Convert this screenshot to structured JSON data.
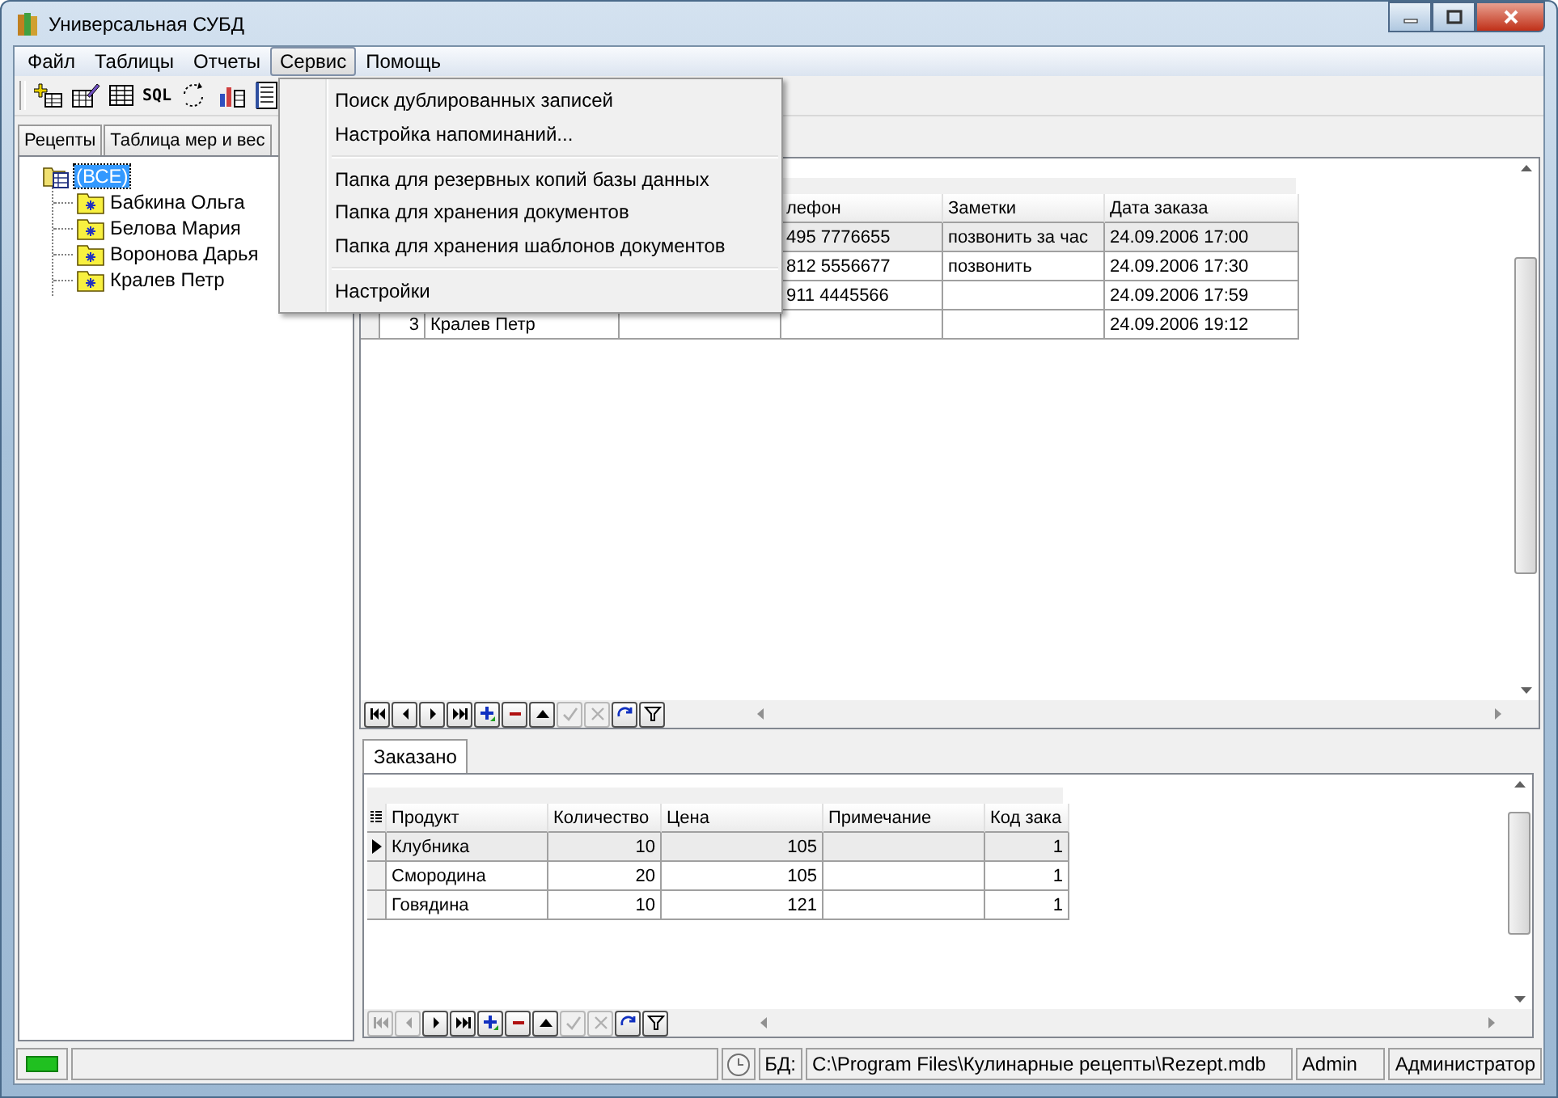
{
  "window": {
    "title": "Универсальная СУБД"
  },
  "menu_bar": [
    {
      "label": "Файл",
      "selected": false
    },
    {
      "label": "Таблицы",
      "selected": false
    },
    {
      "label": "Отчеты",
      "selected": false
    },
    {
      "label": "Сервис",
      "selected": true
    },
    {
      "label": "Помощь",
      "selected": false
    }
  ],
  "toolbar": {
    "sql_label": "SQL"
  },
  "open_menu": {
    "items": [
      {
        "kind": "item",
        "label": "Поиск дублированных записей"
      },
      {
        "kind": "item",
        "label": "Настройка напоминаний..."
      },
      {
        "kind": "separator"
      },
      {
        "kind": "item",
        "label": "Папка для резервных копий базы данных"
      },
      {
        "kind": "item",
        "label": "Папка для хранения документов"
      },
      {
        "kind": "item",
        "label": "Папка для хранения шаблонов документов"
      },
      {
        "kind": "separator"
      },
      {
        "kind": "item",
        "label": "Настройки"
      }
    ]
  },
  "left_tabs": [
    {
      "label": "Рецепты",
      "selected": false
    },
    {
      "label": "Таблица мер и вес",
      "selected": false
    }
  ],
  "tree": {
    "label": "(ВСЕ)",
    "selected": true,
    "children": [
      {
        "label": "Бабкина Ольга",
        "selected": false
      },
      {
        "label": "Белова Мария",
        "selected": false
      },
      {
        "label": "Воронова Дарья",
        "selected": false
      },
      {
        "label": "Кралев Петр",
        "selected": false
      }
    ]
  },
  "upper_table": {
    "headers": {
      "phone": "лефон",
      "notes": "Заметки",
      "date": "Дата заказа"
    },
    "rows": [
      {
        "selected": true,
        "phone": "495 7776655",
        "notes": "позвонить за час",
        "date": "24.09.2006 17:00"
      },
      {
        "selected": false,
        "phone": "812 5556677",
        "notes": "позвонить",
        "date": "24.09.2006 17:30"
      },
      {
        "selected": false,
        "phone": "911 4445566",
        "date": "24.09.2006 17:59"
      },
      {
        "selected": false,
        "number": "3",
        "name": "Кралев Петр",
        "date": "24.09.2006 19:12"
      }
    ]
  },
  "upper_navigator": [
    {
      "kind": "first",
      "disabled": false
    },
    {
      "kind": "prior",
      "disabled": false
    },
    {
      "kind": "next",
      "disabled": false
    },
    {
      "kind": "last",
      "disabled": false
    },
    {
      "kind": "insert",
      "disabled": false
    },
    {
      "kind": "delete",
      "disabled": false
    },
    {
      "kind": "edit",
      "disabled": false
    },
    {
      "kind": "post",
      "disabled": true
    },
    {
      "kind": "cancel",
      "disabled": true
    },
    {
      "kind": "refresh",
      "disabled": false
    },
    {
      "kind": "filter",
      "disabled": false
    }
  ],
  "lower_tab": {
    "label": "Заказано",
    "selected": true
  },
  "lower_table": {
    "columns": [
      "Продукт",
      "Количество",
      "Цена",
      "Примечание",
      "Код зака"
    ],
    "rows": [
      {
        "selected": true,
        "product": "Клубника",
        "quantity": "10",
        "price": "105",
        "code": "1"
      },
      {
        "selected": false,
        "product": "Смородина",
        "quantity": "20",
        "price": "105",
        "code": "1"
      },
      {
        "selected": false,
        "product": "Говядина",
        "quantity": "10",
        "price": "121",
        "code": "1"
      }
    ]
  },
  "lower_navigator": [
    {
      "kind": "first",
      "disabled": true
    },
    {
      "kind": "prior",
      "disabled": true
    },
    {
      "kind": "next",
      "disabled": false
    },
    {
      "kind": "last",
      "disabled": false
    },
    {
      "kind": "insert",
      "disabled": false
    },
    {
      "kind": "delete",
      "disabled": false
    },
    {
      "kind": "edit",
      "disabled": false
    },
    {
      "kind": "post",
      "disabled": true
    },
    {
      "kind": "cancel",
      "disabled": true
    },
    {
      "kind": "refresh",
      "disabled": false
    },
    {
      "kind": "filter",
      "disabled": false
    }
  ],
  "status_bar": {
    "connected": true,
    "db_label": "БД:",
    "path": "C:\\Program Files\\Кулинарные рецепты\\Rezept.mdb",
    "user": "Admin",
    "role": "Администратор"
  }
}
